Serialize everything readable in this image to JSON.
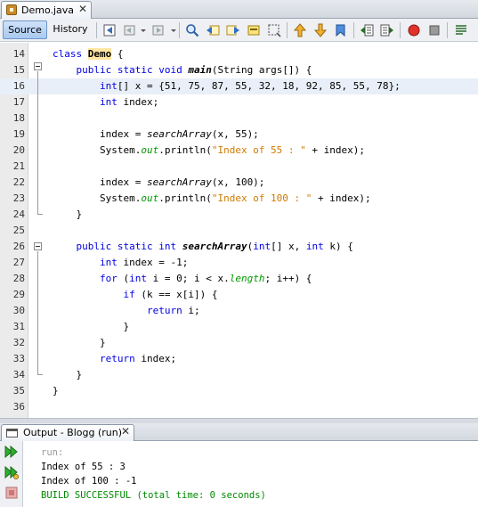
{
  "editor_tab": {
    "title": "Demo.java",
    "close": "✕"
  },
  "toolbar": {
    "source_label": "Source",
    "history_label": "History",
    "icons": [
      "last-edit-icon",
      "back-icon",
      "forward-icon",
      "find-icon",
      "find-previous-icon",
      "find-next-icon",
      "toggle-highlight-icon",
      "toggle-rectangular-selection-icon",
      "previous-bookmark-icon",
      "next-bookmark-icon",
      "toggle-bookmark-icon",
      "shift-left-icon",
      "shift-right-icon",
      "start-macro-icon",
      "stop-macro-icon",
      "comment-icon"
    ]
  },
  "editor": {
    "current_line": "16",
    "lines": [
      {
        "num": "14",
        "tokens": [
          {
            "t": "class ",
            "c": "kw"
          },
          {
            "t": "Demo",
            "c": "cls"
          },
          {
            "t": " {",
            "c": ""
          }
        ]
      },
      {
        "num": "15",
        "tokens": [
          {
            "t": "    ",
            "c": ""
          },
          {
            "t": "public static void ",
            "c": "kw"
          },
          {
            "t": "main",
            "c": "mth"
          },
          {
            "t": "(String args[]) {",
            "c": ""
          }
        ]
      },
      {
        "num": "16",
        "tokens": [
          {
            "t": "        ",
            "c": ""
          },
          {
            "t": "int",
            "c": "kw"
          },
          {
            "t": "[] x = {51, 75, 87, 55, 32, 18, 92, 85, 55, 78};",
            "c": ""
          }
        ]
      },
      {
        "num": "17",
        "tokens": [
          {
            "t": "        ",
            "c": ""
          },
          {
            "t": "int",
            "c": "kw"
          },
          {
            "t": " index;",
            "c": ""
          }
        ]
      },
      {
        "num": "18",
        "tokens": []
      },
      {
        "num": "19",
        "tokens": [
          {
            "t": "        index = ",
            "c": ""
          },
          {
            "t": "searchArray",
            "c": "smth"
          },
          {
            "t": "(x, 55);",
            "c": ""
          }
        ]
      },
      {
        "num": "20",
        "tokens": [
          {
            "t": "        System.",
            "c": ""
          },
          {
            "t": "out",
            "c": "fld"
          },
          {
            "t": ".println(",
            "c": ""
          },
          {
            "t": "\"Index of 55 : \"",
            "c": "str"
          },
          {
            "t": " + index);",
            "c": ""
          }
        ]
      },
      {
        "num": "21",
        "tokens": []
      },
      {
        "num": "22",
        "tokens": [
          {
            "t": "        index = ",
            "c": ""
          },
          {
            "t": "searchArray",
            "c": "smth"
          },
          {
            "t": "(x, 100);",
            "c": ""
          }
        ]
      },
      {
        "num": "23",
        "tokens": [
          {
            "t": "        System.",
            "c": ""
          },
          {
            "t": "out",
            "c": "fld"
          },
          {
            "t": ".println(",
            "c": ""
          },
          {
            "t": "\"Index of 100 : \"",
            "c": "str"
          },
          {
            "t": " + index);",
            "c": ""
          }
        ]
      },
      {
        "num": "24",
        "tokens": [
          {
            "t": "    }",
            "c": ""
          }
        ]
      },
      {
        "num": "25",
        "tokens": []
      },
      {
        "num": "26",
        "tokens": [
          {
            "t": "    ",
            "c": ""
          },
          {
            "t": "public static int ",
            "c": "kw"
          },
          {
            "t": "searchArray",
            "c": "mth"
          },
          {
            "t": "(",
            "c": ""
          },
          {
            "t": "int",
            "c": "kw"
          },
          {
            "t": "[] x, ",
            "c": ""
          },
          {
            "t": "int",
            "c": "kw"
          },
          {
            "t": " k) {",
            "c": ""
          }
        ]
      },
      {
        "num": "27",
        "tokens": [
          {
            "t": "        ",
            "c": ""
          },
          {
            "t": "int",
            "c": "kw"
          },
          {
            "t": " index = -1;",
            "c": ""
          }
        ]
      },
      {
        "num": "28",
        "tokens": [
          {
            "t": "        ",
            "c": ""
          },
          {
            "t": "for",
            "c": "kw"
          },
          {
            "t": " (",
            "c": ""
          },
          {
            "t": "int",
            "c": "kw"
          },
          {
            "t": " i = 0; i < x.",
            "c": ""
          },
          {
            "t": "length",
            "c": "fld"
          },
          {
            "t": "; i++) {",
            "c": ""
          }
        ]
      },
      {
        "num": "29",
        "tokens": [
          {
            "t": "            ",
            "c": ""
          },
          {
            "t": "if",
            "c": "kw"
          },
          {
            "t": " (k == x[i]) {",
            "c": ""
          }
        ]
      },
      {
        "num": "30",
        "tokens": [
          {
            "t": "                ",
            "c": ""
          },
          {
            "t": "return",
            "c": "kw"
          },
          {
            "t": " i;",
            "c": ""
          }
        ]
      },
      {
        "num": "31",
        "tokens": [
          {
            "t": "            }",
            "c": ""
          }
        ]
      },
      {
        "num": "32",
        "tokens": [
          {
            "t": "        }",
            "c": ""
          }
        ]
      },
      {
        "num": "33",
        "tokens": [
          {
            "t": "        ",
            "c": ""
          },
          {
            "t": "return",
            "c": "kw"
          },
          {
            "t": " index;",
            "c": ""
          }
        ]
      },
      {
        "num": "34",
        "tokens": [
          {
            "t": "    }",
            "c": ""
          }
        ]
      },
      {
        "num": "35",
        "tokens": [
          {
            "t": "}",
            "c": ""
          }
        ]
      },
      {
        "num": "36",
        "tokens": []
      }
    ]
  },
  "output": {
    "tab_title": "Output - Blogg (run)",
    "close": "✕",
    "side_icons": [
      "rerun-icon",
      "rerun-with-options-icon",
      "stop-icon"
    ],
    "lines": [
      {
        "text": "run:",
        "kind": "run"
      },
      {
        "text": "Index of 55 : 3",
        "kind": "normal"
      },
      {
        "text": "Index of 100 : -1",
        "kind": "normal"
      },
      {
        "text": "BUILD SUCCESSFUL (total time: 0 seconds)",
        "kind": "success"
      }
    ]
  }
}
